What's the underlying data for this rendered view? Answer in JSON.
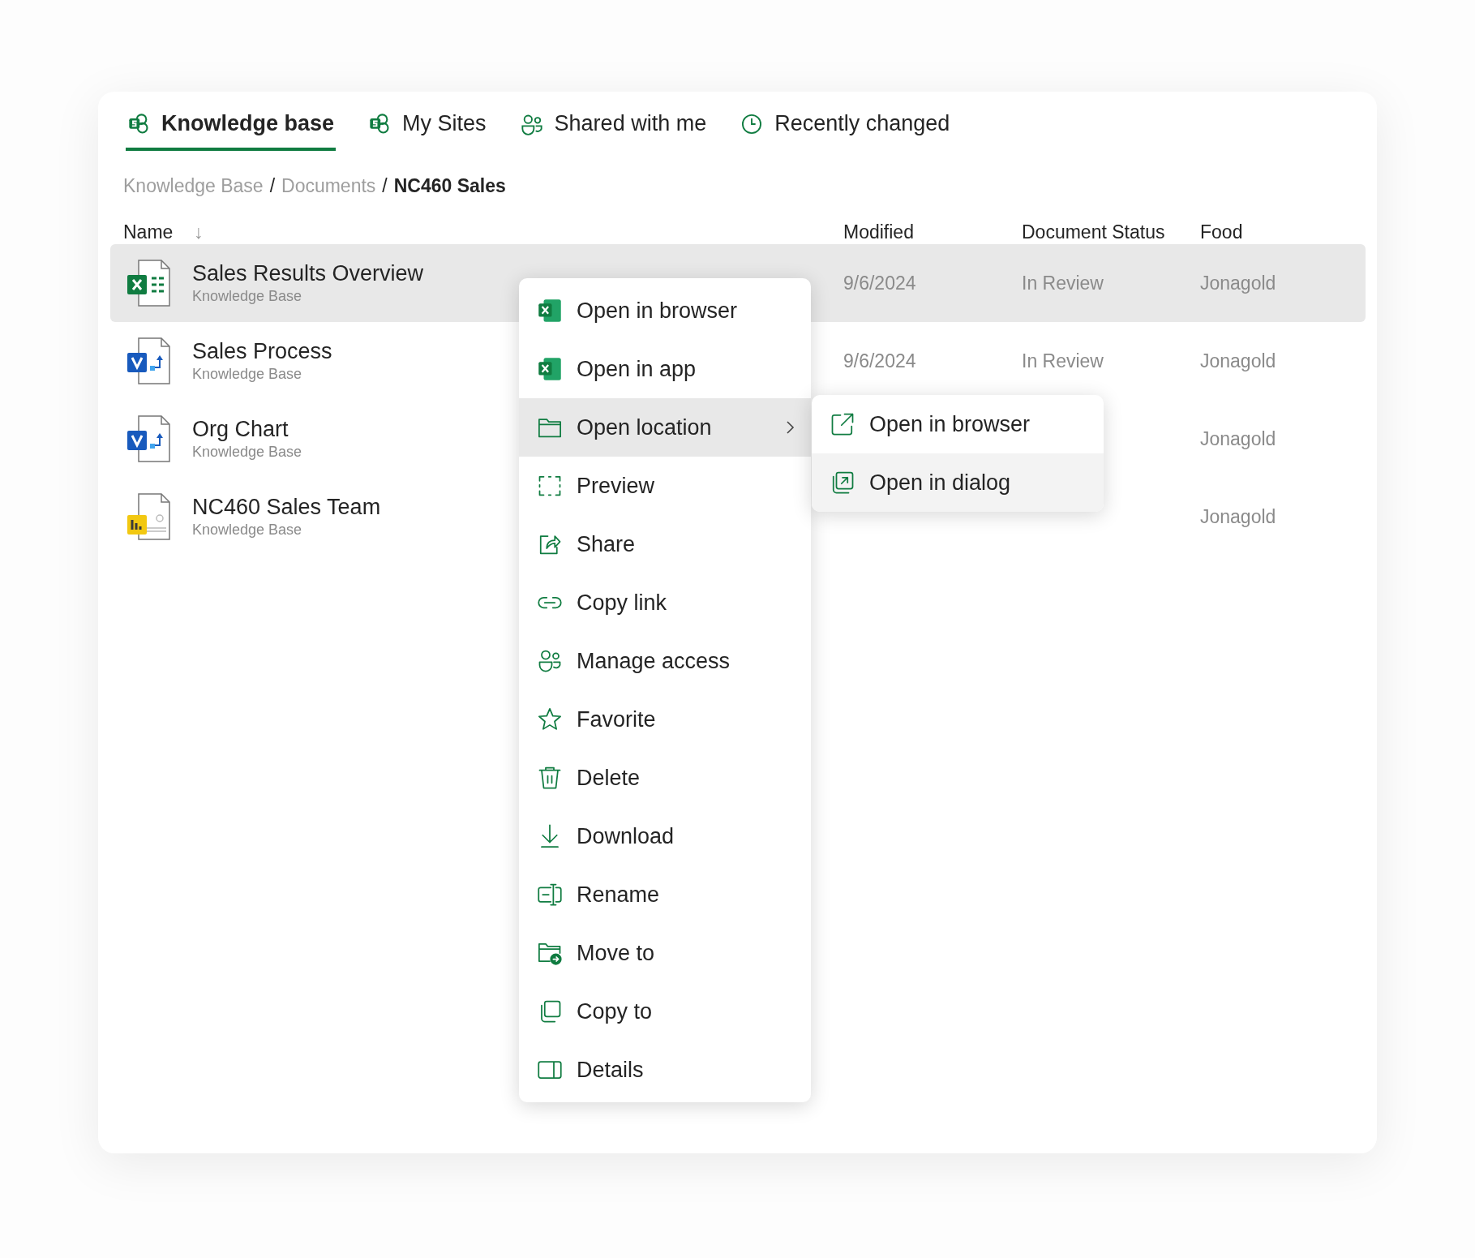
{
  "tabs": [
    {
      "label": "Knowledge base",
      "selected": true
    },
    {
      "label": "My Sites",
      "selected": false
    },
    {
      "label": "Shared with me",
      "selected": false
    },
    {
      "label": "Recently changed",
      "selected": false
    }
  ],
  "breadcrumb": [
    {
      "label": "Knowledge Base",
      "current": false
    },
    {
      "label": "Documents",
      "current": false
    },
    {
      "label": "NC460 Sales",
      "current": true
    }
  ],
  "breadcrumb_separator": "/",
  "table": {
    "columns": [
      {
        "label": "Name",
        "sort_indicator": "↓"
      },
      {
        "label": "Modified"
      },
      {
        "label": "Document Status"
      },
      {
        "label": "Food"
      }
    ],
    "rows": [
      {
        "kind": "spreadsheet",
        "name": "Sales Results Overview",
        "location": "Knowledge Base",
        "modified": "9/6/2024",
        "status": "In Review",
        "food": "Jonagold",
        "selected": true
      },
      {
        "kind": "diagram",
        "name": "Sales Process",
        "location": "Knowledge Base",
        "modified": "9/6/2024",
        "status": "In Review",
        "food": "Jonagold",
        "selected": false
      },
      {
        "kind": "diagram",
        "name": "Org Chart",
        "location": "Knowledge Base",
        "food": "Jonagold",
        "selected": false
      },
      {
        "kind": "report",
        "name": "NC460 Sales Team",
        "location": "Knowledge Base",
        "food": "Jonagold",
        "selected": false
      }
    ]
  },
  "context_menu": {
    "items": [
      {
        "label": "Open in browser",
        "selected": false
      },
      {
        "label": "Open in app",
        "selected": false
      },
      {
        "label": "Open location",
        "selected": true,
        "has_submenu": true
      },
      {
        "label": "Preview",
        "selected": false
      },
      {
        "label": "Share",
        "selected": false
      },
      {
        "label": "Copy link",
        "selected": false
      },
      {
        "label": "Manage access",
        "selected": false
      },
      {
        "label": "Favorite",
        "selected": false
      },
      {
        "label": "Delete",
        "selected": false
      },
      {
        "label": "Download",
        "selected": false
      },
      {
        "label": "Rename",
        "selected": false
      },
      {
        "label": "Move to",
        "selected": false
      },
      {
        "label": "Copy to",
        "selected": false
      },
      {
        "label": "Details",
        "selected": false
      }
    ],
    "submenu": [
      {
        "label": "Open in browser",
        "selected": false
      },
      {
        "label": "Open in dialog",
        "selected": true
      }
    ]
  }
}
